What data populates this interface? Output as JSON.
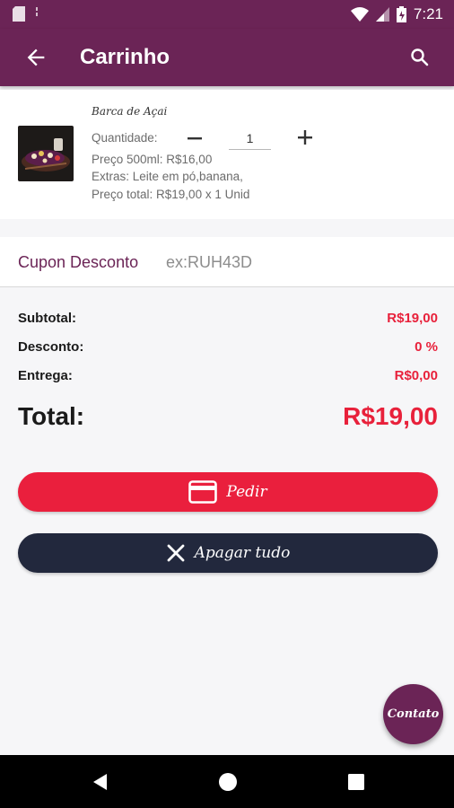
{
  "status_bar": {
    "time": "7:21"
  },
  "app_bar": {
    "title": "Carrinho"
  },
  "item": {
    "name": "Barca de Açai",
    "quantity_label": "Quantidade:",
    "quantity": "1",
    "price": "Preço 500ml:  R$16,00",
    "extras": "Extras: Leite em pó,banana,",
    "total_price": "Preço total:  R$19,00 x 1 Unid"
  },
  "coupon": {
    "label": "Cupon Desconto",
    "placeholder": "ex:RUH43D",
    "value": ""
  },
  "summary": {
    "subtotal_label": "Subtotal:",
    "subtotal_value": "R$19,00",
    "discount_label": "Desconto:",
    "discount_value": "0 %",
    "delivery_label": "Entrega:",
    "delivery_value": "R$0,00",
    "total_label": "Total:",
    "total_value": "R$19,00"
  },
  "actions": {
    "order_label": "Pedir",
    "clear_label": "Apagar tudo"
  },
  "fab": {
    "label": "Contato"
  },
  "colors": {
    "primary": "#6b2456",
    "accent_red": "#e8213b",
    "dark_button": "#22283d"
  },
  "icons": [
    "back-arrow-icon",
    "search-icon",
    "minus-icon",
    "plus-icon",
    "credit-card-icon",
    "close-icon"
  ]
}
